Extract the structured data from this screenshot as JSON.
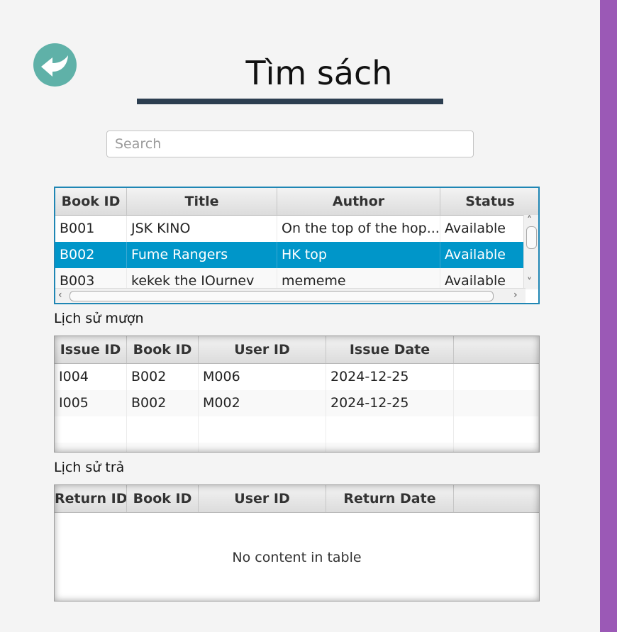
{
  "page": {
    "title": "Tìm sách",
    "back_icon": "back-arrow-icon",
    "accent_color": "#9b59b6",
    "back_button_color": "#5fb1a8",
    "selection_color": "#0096c9",
    "rule_color": "#2c3e50"
  },
  "search": {
    "placeholder": "Search",
    "value": ""
  },
  "books_table": {
    "columns": [
      "Book ID",
      "Title",
      "Author",
      "Status"
    ],
    "rows": [
      [
        "B001",
        "JSK KINO",
        "On the top of the hop...",
        "Available"
      ],
      [
        "B002",
        "Fume Rangers",
        "HK top",
        "Available"
      ],
      [
        "B003",
        "kekek the IOurnev",
        "mememe",
        "Available"
      ]
    ],
    "selected_row": 1
  },
  "borrow_history": {
    "label": "Lịch sử mượn",
    "columns": [
      "Issue ID",
      "Book ID",
      "User ID",
      "Issue Date",
      ""
    ],
    "rows": [
      [
        "I004",
        "B002",
        "M006",
        "2024-12-25",
        ""
      ],
      [
        "I005",
        "B002",
        "M002",
        "2024-12-25",
        ""
      ]
    ]
  },
  "return_history": {
    "label": "Lịch sử trả",
    "columns": [
      "Return ID",
      "Book ID",
      "User ID",
      "Return Date",
      ""
    ],
    "empty_message": "No content in table"
  }
}
